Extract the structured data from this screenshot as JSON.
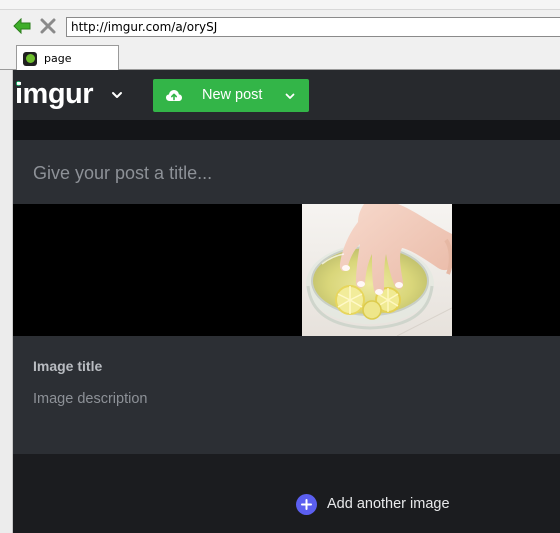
{
  "browser": {
    "address": "http://imgur.com/a/orySJ",
    "tab_title": "page",
    "icons": {
      "back": "back-arrow-icon",
      "stop": "stop-icon",
      "favicon": "imgur-favicon-icon"
    }
  },
  "header": {
    "logo": "imgur",
    "new_post_label": "New post",
    "icons": {
      "logo_menu": "chevron-down-icon",
      "upload": "cloud-upload-icon",
      "new_post_menu": "chevron-down-icon"
    }
  },
  "post": {
    "title_placeholder": "Give your post a title...",
    "title_value": "",
    "image_title": "Image title",
    "image_description": "Image description"
  },
  "add_image": {
    "label": "Add another image",
    "icon": "plus-circle-icon"
  },
  "colors": {
    "brand_green": "#33b548",
    "accent_blue": "#5b5ff0",
    "page_bg": "#1b1c1f",
    "card_bg": "#2c2f34",
    "header_bg": "#27292d"
  }
}
